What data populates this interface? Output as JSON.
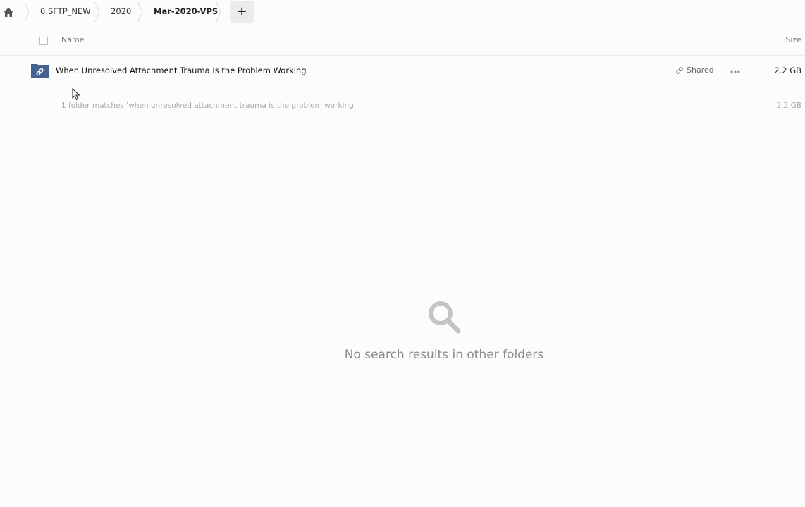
{
  "breadcrumb": {
    "home_icon": "home-icon",
    "items": [
      {
        "label": "0.SFTP_NEW"
      },
      {
        "label": "2020"
      },
      {
        "label": "Mar-2020-VPS"
      }
    ],
    "add_label": "+"
  },
  "list_header": {
    "name_label": "Name",
    "size_label": "Size"
  },
  "files": [
    {
      "name": "When Unresolved Attachment Trauma Is the Problem Working",
      "icon": "shared-folder-icon",
      "shared_label": "Shared",
      "size": "2.2 GB"
    }
  ],
  "summary": {
    "text": "1 folder matches 'when unresolved attachment trauma is the problem working'",
    "size": "2.2 GB"
  },
  "empty_state": {
    "icon": "search-icon",
    "message": "No search results in other folders"
  },
  "colors": {
    "folder_blue": "#44628f",
    "muted_text": "#a9a9a9",
    "background": "#fcfcfd"
  }
}
